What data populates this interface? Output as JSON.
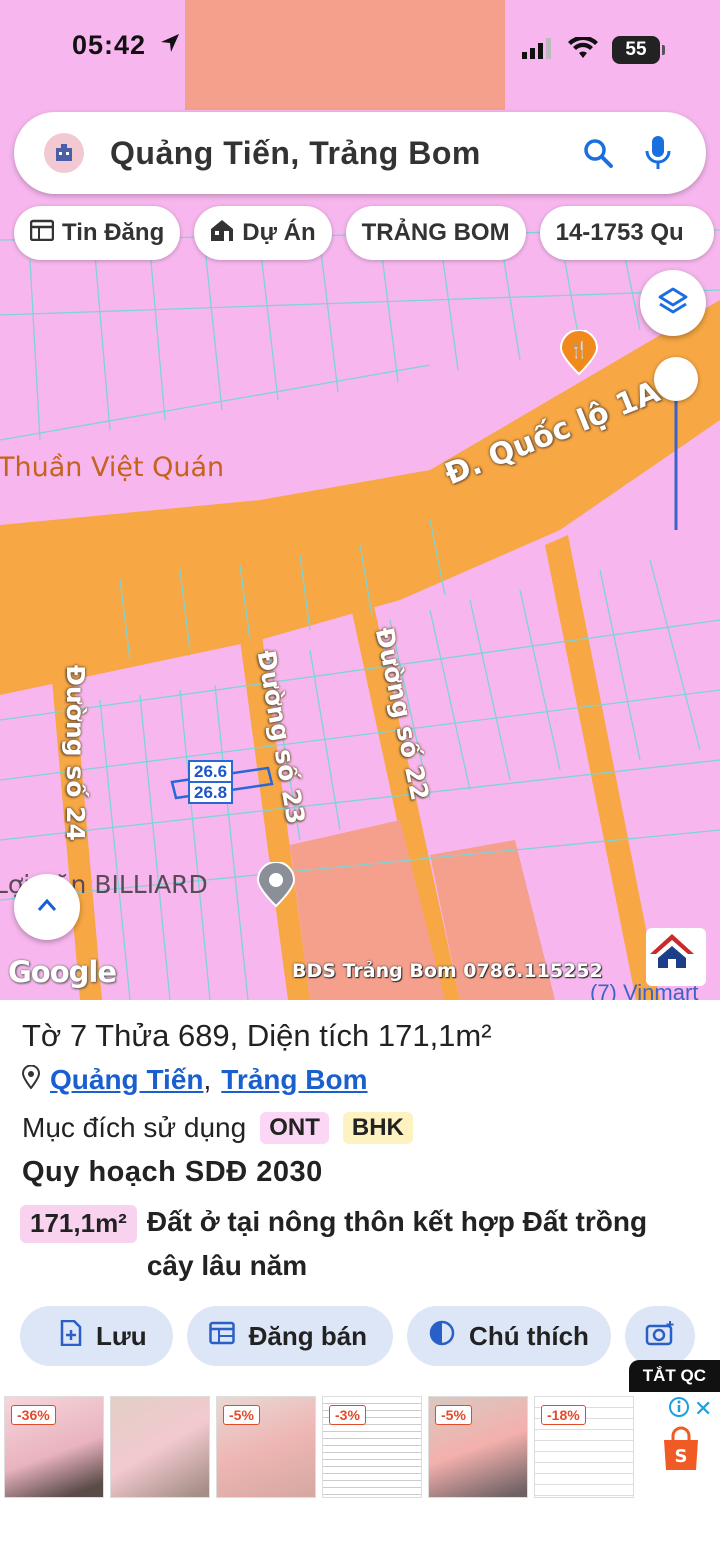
{
  "status_bar": {
    "time": "05:42",
    "battery": "55"
  },
  "search": {
    "query": "Quảng Tiến, Trảng Bom"
  },
  "chips": [
    {
      "label": "Tin Đăng",
      "icon": "calendar-icon"
    },
    {
      "label": "Dự Án",
      "icon": "building-icon"
    },
    {
      "label": "TRẢNG BOM",
      "icon": ""
    },
    {
      "label": "14-1753 Qu",
      "icon": ""
    }
  ],
  "map": {
    "road_main": "Đ. Quốc lộ 1A",
    "road_24": "Đường số 24",
    "road_23": "Đường số 23",
    "road_22": "Đường số 22",
    "poi_restaurant": "Thuần Việt Quán",
    "poi_billiard": "Lợi Văn BILLIARD",
    "lengths": [
      "26.6",
      "26.8"
    ],
    "provider": "Google",
    "watermark": "BDS Trảng Bom 0786.115252",
    "poi_store": "(7) Vinmart"
  },
  "parcel": {
    "title": "Tờ 7 Thửa 689, Diện tích 171,1m²",
    "ward": "Quảng Tiến",
    "separator": ",",
    "district": "Trảng Bom",
    "purpose_label": "Mục đích sử dụng",
    "purpose_codes": [
      {
        "code": "ONT",
        "color": "#fcd7f5"
      },
      {
        "code": "BHK",
        "color": "#fdf2c0"
      }
    ],
    "plan_title": "Quy hoạch SDĐ 2030",
    "area": "171,1m²",
    "area_description": "Đất ở tại nông thôn kết hợp Đất trồng cây lâu năm"
  },
  "actions": [
    {
      "label": "Lưu",
      "icon": "add-document-icon"
    },
    {
      "label": "Đăng bán",
      "icon": "calendar-icon"
    },
    {
      "label": "Chú thích",
      "icon": "contrast-icon"
    }
  ],
  "ads": {
    "close_label": "TẮT QC",
    "discounts": [
      "-36%",
      "-5%",
      "-3%",
      "-5%",
      "-18%"
    ]
  },
  "colors": {
    "land_pink": "#f7b7ee",
    "road_orange": "#f7a743",
    "link_blue": "#1a5fd0",
    "button_bg": "#dde6f6"
  }
}
